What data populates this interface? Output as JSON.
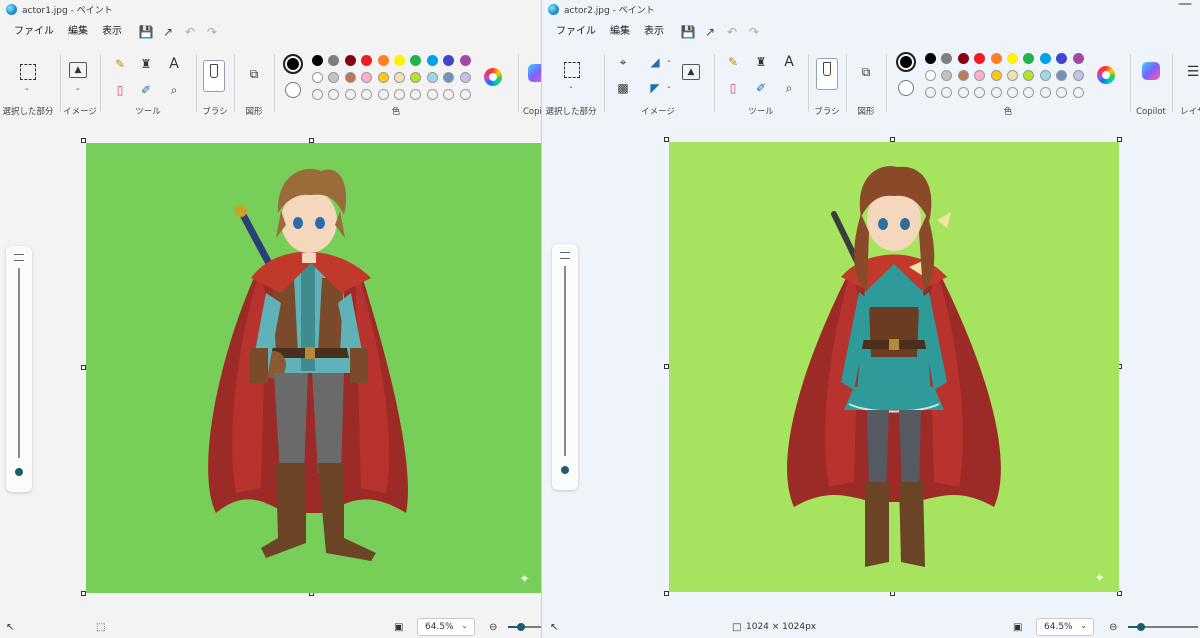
{
  "windows": [
    {
      "title": "actor1.jpg - ペイント",
      "menu": [
        "ファイル",
        "編集",
        "表示"
      ],
      "groups": {
        "selection": "選択した部分",
        "image": "イメージ",
        "tools": "ツール",
        "brushes": "ブラシ",
        "shapes": "図形",
        "colors": "色",
        "copilot": "Copil"
      },
      "canvas_color": "#77cf5a",
      "zoom": "64.5%",
      "image_size": "",
      "icons": [
        "select-rect-icon",
        "image-icon",
        "pencil-icon",
        "fill-icon",
        "text-icon",
        "eraser-icon",
        "color-picker-icon",
        "magnifier-icon",
        "brush-icon",
        "shapes-icon",
        "color-wheel-icon",
        "copilot-icon"
      ]
    },
    {
      "title": "actor2.jpg - ペイント",
      "menu": [
        "ファイル",
        "編集",
        "表示"
      ],
      "groups": {
        "selection": "選択した部分",
        "image": "イメージ",
        "tools": "ツール",
        "brushes": "ブラシ",
        "shapes": "図形",
        "colors": "色",
        "copilot": "Copilot",
        "layers": "レイヤ"
      },
      "canvas_color": "#a6e35e",
      "zoom": "64.5%",
      "image_size": "1024 × 1024px",
      "icons": [
        "select-rect-icon",
        "crop-icon",
        "resize-icon",
        "remove-background-icon",
        "rotate-icon",
        "image-icon",
        "pencil-icon",
        "fill-icon",
        "text-icon",
        "eraser-icon",
        "color-picker-icon",
        "magnifier-icon",
        "brush-icon",
        "shapes-icon",
        "color-wheel-icon",
        "copilot-icon",
        "layers-icon"
      ]
    }
  ],
  "palette": {
    "row1": [
      "#000000",
      "#7f7f7f",
      "#880015",
      "#ed1c24",
      "#ff7f27",
      "#fff200",
      "#22b14c",
      "#00a2e8",
      "#3f48cc",
      "#a349a4"
    ],
    "row2": [
      "#ffffff",
      "#c3c3c3",
      "#b97a57",
      "#ffaec9",
      "#ffc90e",
      "#efe4b0",
      "#b5e61d",
      "#99d9ea",
      "#7092be",
      "#c8bfe7"
    ]
  },
  "characters": {
    "actor1": {
      "hair": "#9b6b3a",
      "cape": "#b8332e",
      "tunic": "#5fb3b8",
      "pants": "#6a6a6a",
      "boots": "#6b4428"
    },
    "actor2": {
      "hair": "#8a4a2a",
      "cape": "#b8332e",
      "tunic": "#2f9a9a",
      "pants": "#555a63",
      "boots": "#6b4428"
    }
  }
}
